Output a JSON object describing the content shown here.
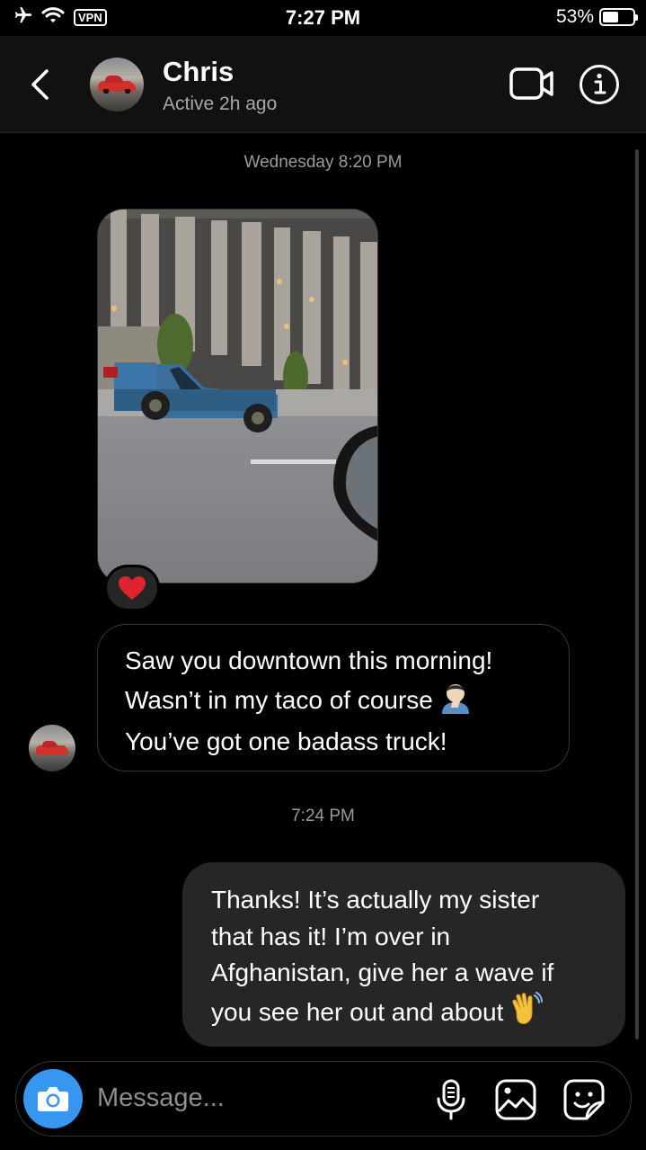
{
  "status_bar": {
    "vpn_label": "VPN",
    "time": "7:27 PM",
    "battery_percent": "53%",
    "battery_level": 0.53,
    "icons": [
      "airplane-icon",
      "wifi-icon",
      "battery-icon"
    ]
  },
  "header": {
    "name": "Chris",
    "status": "Active 2h ago",
    "icons": [
      "back-chevron-icon",
      "video-call-icon",
      "info-icon"
    ]
  },
  "thread": {
    "timestamp_1": "Wednesday 8:20 PM",
    "photo_reaction": "heart-emoji",
    "incoming_message": {
      "lines": [
        "Saw you downtown this morning!",
        "Wasn’t in my taco of course",
        "You’ve got one badass truck!"
      ],
      "emoji": "facepalm-emoji"
    },
    "timestamp_2": "7:24 PM",
    "outgoing_message": {
      "lines": [
        "Thanks! It’s actually my sister",
        "that has it! I’m over in",
        "Afghanistan, give her a wave if",
        "you see her out and about"
      ],
      "emoji": "waving-hand-emoji"
    }
  },
  "composer": {
    "placeholder": "Message...",
    "icons": [
      "camera-icon",
      "microphone-icon",
      "gallery-icon",
      "sticker-icon"
    ]
  },
  "colors": {
    "background": "#000000",
    "header_bg": "#111111",
    "outgoing_bubble": "#262626",
    "camera_button": "#3796f0",
    "heart": "#e0242f"
  }
}
